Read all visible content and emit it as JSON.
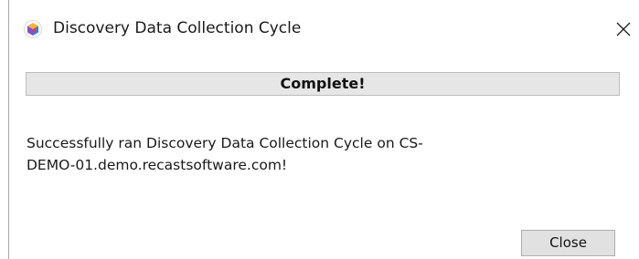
{
  "window": {
    "title": "Discovery Data Collection Cycle",
    "icon": "app-cube-icon",
    "close_icon": "close-icon"
  },
  "progress": {
    "label": "Complete!",
    "value_percent": 100
  },
  "message": {
    "line1": "Successfully ran Discovery Data Collection Cycle on CS-",
    "line2": "DEMO-01.demo.recastsoftware.com!"
  },
  "buttons": {
    "close_label": "Close"
  },
  "colors": {
    "button_bg": "#e1e1e1",
    "progress_bg": "#e6e6e6"
  }
}
